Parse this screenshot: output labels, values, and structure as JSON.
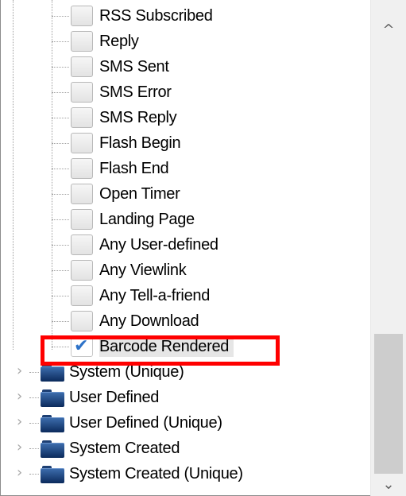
{
  "event_items": [
    {
      "label": "RSS Subscribed",
      "checked": false
    },
    {
      "label": "Reply",
      "checked": false
    },
    {
      "label": "SMS Sent",
      "checked": false
    },
    {
      "label": "SMS Error",
      "checked": false
    },
    {
      "label": "SMS Reply",
      "checked": false
    },
    {
      "label": "Flash Begin",
      "checked": false
    },
    {
      "label": "Flash End",
      "checked": false
    },
    {
      "label": "Open Timer",
      "checked": false
    },
    {
      "label": "Landing Page",
      "checked": false
    },
    {
      "label": "Any User-defined",
      "checked": false
    },
    {
      "label": "Any Viewlink",
      "checked": false
    },
    {
      "label": "Any Tell-a-friend",
      "checked": false
    },
    {
      "label": "Any Download",
      "checked": false
    },
    {
      "label": "Barcode Rendered",
      "checked": true,
      "selected": true
    }
  ],
  "categories": [
    {
      "label": "System (Unique)",
      "icon": "folder-icon"
    },
    {
      "label": "User Defined",
      "icon": "folder-icon"
    },
    {
      "label": "User Defined (Unique)",
      "icon": "folder-icon"
    },
    {
      "label": "System Created",
      "icon": "folder-icon"
    },
    {
      "label": "System Created (Unique)",
      "icon": "folder-icon"
    }
  ],
  "scrollbar": {
    "up_glyph": "^",
    "down_glyph": "⌄"
  },
  "colors": {
    "highlight": "#ff0000",
    "check": "#2d72c8",
    "folder": "#1d4a8a"
  }
}
